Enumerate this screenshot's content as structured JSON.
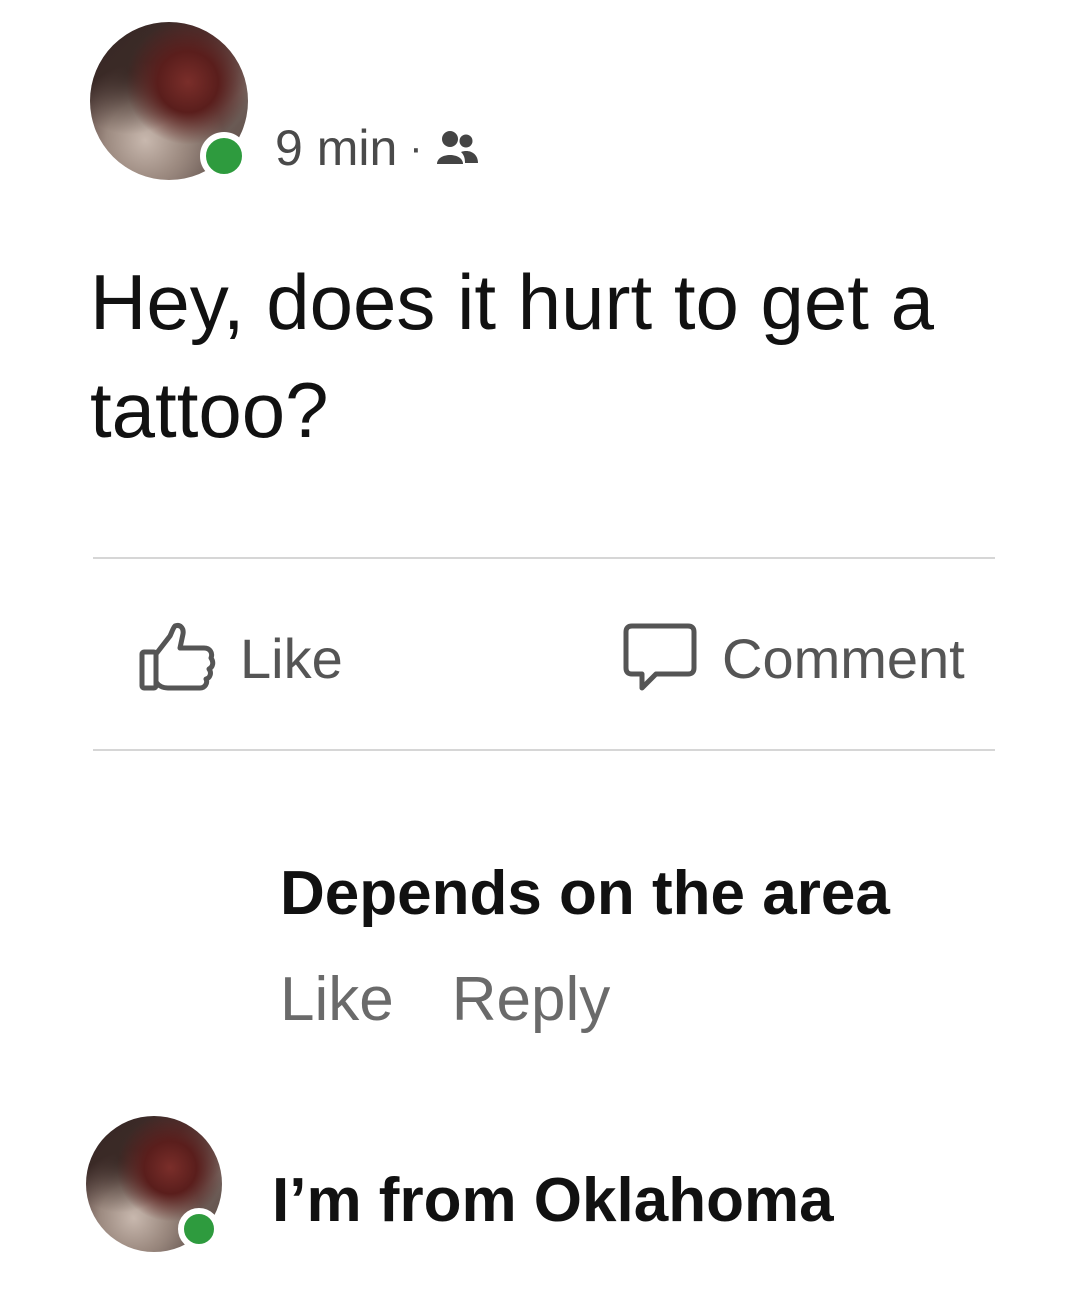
{
  "post": {
    "time": "9 min",
    "separator": "·",
    "audience_icon": "friends-icon",
    "text": "Hey, does it hurt to get a tattoo?"
  },
  "actions": {
    "like_label": "Like",
    "like_icon": "thumbs-up-icon",
    "comment_label": "Comment",
    "comment_icon": "speech-bubble-icon"
  },
  "comment": {
    "text": "Depends on the area",
    "like_label": "Like",
    "reply_label": "Reply"
  },
  "reply": {
    "text": "I’m from Oklahoma"
  },
  "colors": {
    "online": "#2e9b3e",
    "divider": "#d6d6d6",
    "action_text": "#555555"
  }
}
